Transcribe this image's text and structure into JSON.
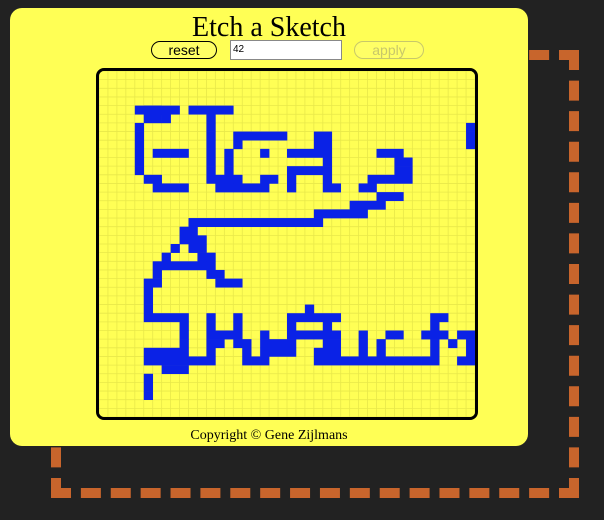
{
  "app": {
    "title": "Etch a Sketch"
  },
  "controls": {
    "reset_label": "reset",
    "grid_size_value": "42",
    "apply_label": "apply"
  },
  "footer": {
    "copyright": "Copyright © Gene Zijlmans"
  },
  "colors": {
    "background": "#222222",
    "card": "#ffff55",
    "ink": "#0a22e6",
    "frame": "#c8652c",
    "gridline": "#e8e84a"
  },
  "board": {
    "cols": 42,
    "rows": 40,
    "filled_runs": [
      [
        4,
        4,
        8
      ],
      [
        5,
        4,
        6
      ],
      [
        10,
        4,
        14
      ],
      [
        5,
        5,
        6
      ],
      [
        7,
        5,
        7
      ],
      [
        12,
        5,
        12
      ],
      [
        4,
        6,
        4
      ],
      [
        12,
        6,
        12
      ],
      [
        41,
        6,
        41
      ],
      [
        4,
        7,
        4
      ],
      [
        12,
        7,
        12
      ],
      [
        15,
        7,
        20
      ],
      [
        24,
        7,
        25
      ],
      [
        41,
        7,
        41
      ],
      [
        4,
        8,
        4
      ],
      [
        12,
        8,
        12
      ],
      [
        15,
        8,
        15
      ],
      [
        24,
        8,
        25
      ],
      [
        41,
        8,
        41
      ],
      [
        4,
        9,
        4
      ],
      [
        6,
        9,
        9
      ],
      [
        12,
        9,
        12
      ],
      [
        14,
        9,
        14
      ],
      [
        18,
        9,
        18
      ],
      [
        21,
        9,
        25
      ],
      [
        31,
        9,
        33
      ],
      [
        4,
        10,
        4
      ],
      [
        12,
        10,
        12
      ],
      [
        14,
        10,
        14
      ],
      [
        25,
        10,
        25
      ],
      [
        33,
        10,
        34
      ],
      [
        4,
        11,
        4
      ],
      [
        12,
        11,
        12
      ],
      [
        14,
        11,
        14
      ],
      [
        21,
        11,
        25
      ],
      [
        33,
        11,
        34
      ],
      [
        5,
        12,
        6
      ],
      [
        12,
        12,
        13
      ],
      [
        14,
        12,
        15
      ],
      [
        18,
        12,
        19
      ],
      [
        21,
        12,
        21
      ],
      [
        25,
        12,
        25
      ],
      [
        30,
        12,
        34
      ],
      [
        6,
        13,
        9
      ],
      [
        13,
        13,
        14
      ],
      [
        15,
        13,
        18
      ],
      [
        21,
        13,
        21
      ],
      [
        25,
        13,
        26
      ],
      [
        29,
        13,
        30
      ],
      [
        31,
        14,
        33
      ],
      [
        28,
        15,
        31
      ],
      [
        24,
        16,
        29
      ],
      [
        10,
        17,
        24
      ],
      [
        9,
        18,
        10
      ],
      [
        9,
        19,
        11
      ],
      [
        8,
        20,
        8
      ],
      [
        10,
        20,
        11
      ],
      [
        7,
        21,
        7
      ],
      [
        11,
        21,
        12
      ],
      [
        6,
        22,
        11
      ],
      [
        12,
        22,
        12
      ],
      [
        6,
        23,
        6
      ],
      [
        12,
        23,
        13
      ],
      [
        5,
        24,
        6
      ],
      [
        13,
        24,
        15
      ],
      [
        5,
        25,
        5
      ],
      [
        5,
        26,
        5
      ],
      [
        5,
        27,
        5
      ],
      [
        23,
        27,
        23
      ],
      [
        5,
        28,
        9
      ],
      [
        12,
        28,
        12
      ],
      [
        15,
        28,
        15
      ],
      [
        21,
        28,
        26
      ],
      [
        37,
        28,
        38
      ],
      [
        9,
        29,
        9
      ],
      [
        12,
        29,
        12
      ],
      [
        15,
        29,
        15
      ],
      [
        21,
        29,
        21
      ],
      [
        25,
        29,
        25
      ],
      [
        37,
        29,
        37
      ],
      [
        9,
        30,
        9
      ],
      [
        12,
        30,
        15
      ],
      [
        18,
        30,
        18
      ],
      [
        21,
        30,
        26
      ],
      [
        29,
        30,
        29
      ],
      [
        32,
        30,
        33
      ],
      [
        36,
        30,
        38
      ],
      [
        40,
        30,
        41
      ],
      [
        9,
        31,
        9
      ],
      [
        12,
        31,
        13
      ],
      [
        15,
        31,
        16
      ],
      [
        18,
        31,
        21
      ],
      [
        25,
        31,
        26
      ],
      [
        29,
        31,
        29
      ],
      [
        31,
        31,
        31
      ],
      [
        37,
        31,
        37
      ],
      [
        39,
        31,
        39
      ],
      [
        41,
        31,
        41
      ],
      [
        5,
        32,
        9
      ],
      [
        12,
        32,
        12
      ],
      [
        16,
        32,
        16
      ],
      [
        18,
        32,
        21
      ],
      [
        24,
        32,
        26
      ],
      [
        29,
        32,
        29
      ],
      [
        31,
        32,
        31
      ],
      [
        37,
        32,
        37
      ],
      [
        41,
        32,
        41
      ],
      [
        5,
        33,
        12
      ],
      [
        16,
        33,
        18
      ],
      [
        24,
        33,
        31
      ],
      [
        32,
        33,
        37
      ],
      [
        40,
        33,
        41
      ],
      [
        7,
        34,
        9
      ],
      [
        5,
        35,
        5
      ],
      [
        5,
        36,
        5
      ],
      [
        5,
        37,
        5
      ]
    ]
  }
}
